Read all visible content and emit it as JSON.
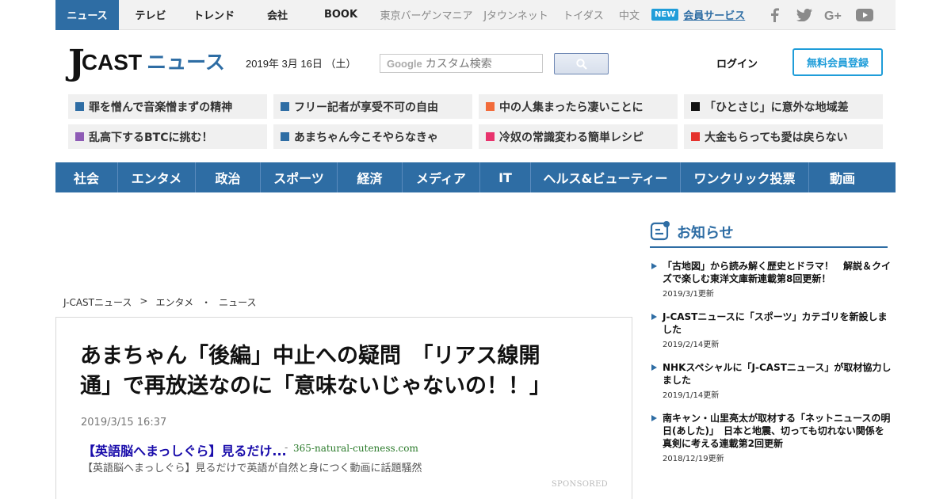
{
  "topnav": {
    "items": [
      "ニュース",
      "テレビ",
      "トレンド",
      "会社",
      "BOOK"
    ],
    "external": [
      "東京バーゲンマニア",
      "Jタウンネット",
      "トイダス",
      "中文"
    ],
    "new_badge": "NEW",
    "member_service": "会員サービス",
    "social_icons": [
      "facebook-icon",
      "twitter-icon",
      "google-plus-icon",
      "youtube-icon"
    ]
  },
  "header": {
    "logo_j": "J",
    "logo_cast": "CAST",
    "logo_news": "ニュース",
    "date": "2019年 3月 16日 （土）",
    "search_google": "Google",
    "search_placeholder": "カスタム検索",
    "login": "ログイン",
    "register": "無料会員登録"
  },
  "trending": [
    {
      "label": "罪を憎んで音楽憎まずの精神",
      "color": "#2e6da4"
    },
    {
      "label": "フリー記者が享受不可の自由",
      "color": "#2e6da4"
    },
    {
      "label": "中の人集まったら凄いことに",
      "color": "#f26b3a"
    },
    {
      "label": "「ひとさじ」に意外な地域差",
      "color": "#111111"
    },
    {
      "label": "乱高下するBTCに挑む！",
      "color": "#8e5bb5"
    },
    {
      "label": "あまちゃん今こそやらなきゃ",
      "color": "#2e6da4"
    },
    {
      "label": "冷奴の常識変わる簡単レシピ",
      "color": "#e8336d"
    },
    {
      "label": "大金もらっても愛は戻らない",
      "color": "#e5322d"
    }
  ],
  "categories": [
    "社会",
    "エンタメ",
    "政治",
    "スポーツ",
    "経済",
    "メディア",
    "IT",
    "ヘルス&ビューティー",
    "ワンクリック投票",
    "動画"
  ],
  "breadcrumb": [
    "J-CASTニュース",
    ">",
    "エンタメ",
    "・",
    "ニュース"
  ],
  "article": {
    "title_line1": "あまちゃん「後編」中止への疑問　「リアス線開",
    "title_line2": "通」で再放送なのに「意味ないじゃないの！！」",
    "timestamp": "2019/3/15 16:37",
    "ad_title": "【英語脳へまっしぐら】見るだけ...",
    "ad_sep": "-",
    "ad_domain": "365-natural-cuteness.com",
    "ad_desc": "【英語脳へまっしぐら】見るだけで英語が自然と身につく動画に話題騒然",
    "sponsored": "SPONSORED"
  },
  "notices": {
    "heading": "お知らせ",
    "items": [
      {
        "text": "「古地図」から読み解く歴史とドラマ！　解説＆クイズで楽しむ東洋文庫新連載第8回更新！",
        "updated": "2019/3/1更新"
      },
      {
        "text": "J-CASTニュースに「スポーツ」カテゴリを新設しました",
        "updated": "2019/2/14更新"
      },
      {
        "text": "NHKスペシャルに「J-CASTニュース」が取材協力しました",
        "updated": "2019/1/14更新"
      },
      {
        "text": "南キャン・山里亮太が取材する「ネットニュースの明日(あした)」　日本と地震、切っても切れない関係を真剣に考える連載第2回更新",
        "updated": "2018/12/19更新"
      }
    ]
  }
}
